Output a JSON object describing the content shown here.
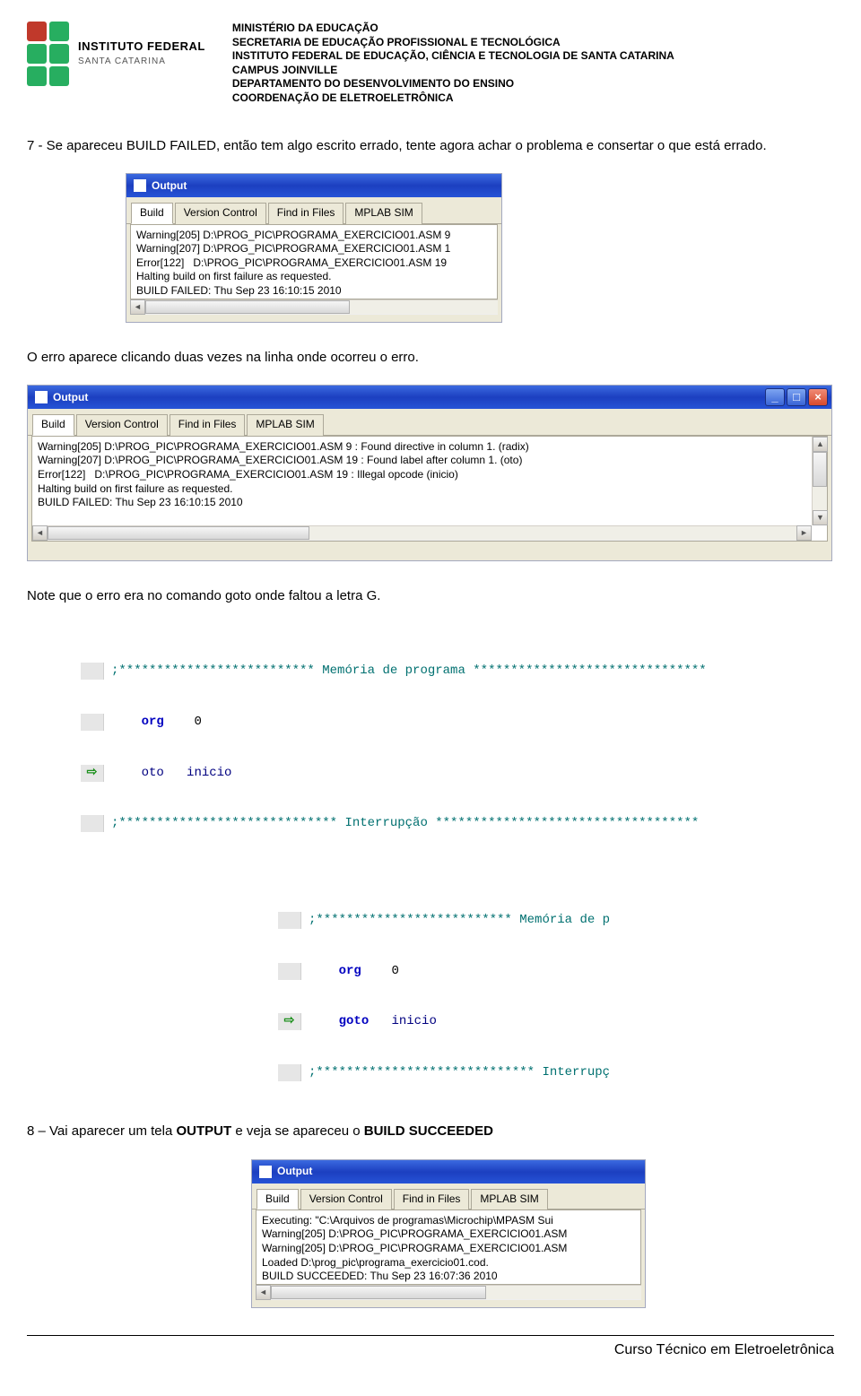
{
  "header": {
    "logo_top": "INSTITUTO FEDERAL",
    "logo_bottom": "SANTA CATARINA",
    "lines": [
      "MINISTÉRIO DA EDUCAÇÃO",
      "SECRETARIA DE EDUCAÇÃO PROFISSIONAL E TECNOLÓGICA",
      "INSTITUTO FEDERAL DE EDUCAÇÃO, CIÊNCIA E TECNOLOGIA DE SANTA CATARINA",
      "CAMPUS JOINVILLE",
      "DEPARTAMENTO DO DESENVOLVIMENTO DO ENSINO",
      "COORDENAÇÃO DE ELETROELETRÔNICA"
    ]
  },
  "para1": "7 - Se apareceu BUILD FAILED, então tem algo escrito errado, tente agora achar o problema e consertar o que está errado.",
  "para2": "O erro aparece clicando duas vezes na linha onde ocorreu o erro.",
  "para3": "Note que o erro era no comando goto onde faltou a letra G.",
  "para4_a": "8 – Vai aparecer um tela ",
  "para4_b": "OUTPUT",
  "para4_c": " e veja se apareceu o ",
  "para4_d": "BUILD SUCCEEDED",
  "win_title": "Output",
  "tabs": [
    "Build",
    "Version Control",
    "Find in Files",
    "MPLAB SIM"
  ],
  "win1_text": "Warning[205] D:\\PROG_PIC\\PROGRAMA_EXERCICIO01.ASM 9\nWarning[207] D:\\PROG_PIC\\PROGRAMA_EXERCICIO01.ASM 1\nError[122]   D:\\PROG_PIC\\PROGRAMA_EXERCICIO01.ASM 19\nHalting build on first failure as requested.\nBUILD FAILED: Thu Sep 23 16:10:15 2010",
  "win2_text": "Warning[205] D:\\PROG_PIC\\PROGRAMA_EXERCICIO01.ASM 9 : Found directive in column 1. (radix)\nWarning[207] D:\\PROG_PIC\\PROGRAMA_EXERCICIO01.ASM 19 : Found label after column 1. (oto)\nError[122]   D:\\PROG_PIC\\PROGRAMA_EXERCICIO01.ASM 19 : Illegal opcode (inicio)\nHalting build on first failure as requested.\nBUILD FAILED: Thu Sep 23 16:10:15 2010",
  "win3_text": "Executing: \"C:\\Arquivos de programas\\Microchip\\MPASM Sui\nWarning[205] D:\\PROG_PIC\\PROGRAMA_EXERCICIO01.ASM\nWarning[205] D:\\PROG_PIC\\PROGRAMA_EXERCICIO01.ASM\nLoaded D:\\prog_pic\\programa_exercicio01.cod.\nBUILD SUCCEEDED: Thu Sep 23 16:07:36 2010",
  "code1": {
    "l1": ";************************** Memória de programa *******************************",
    "l2a": "org",
    "l2b": "0",
    "l3a": "oto",
    "l3b": "inicio",
    "l4": ";***************************** Interrupção ***********************************"
  },
  "code2": {
    "l1": ";************************** Memória de p",
    "l2a": "org",
    "l2b": "0",
    "l3a": "goto",
    "l3b": "inicio",
    "l4": ";***************************** Interrupç"
  },
  "footer": "Curso Técnico em Eletroeletrônica"
}
